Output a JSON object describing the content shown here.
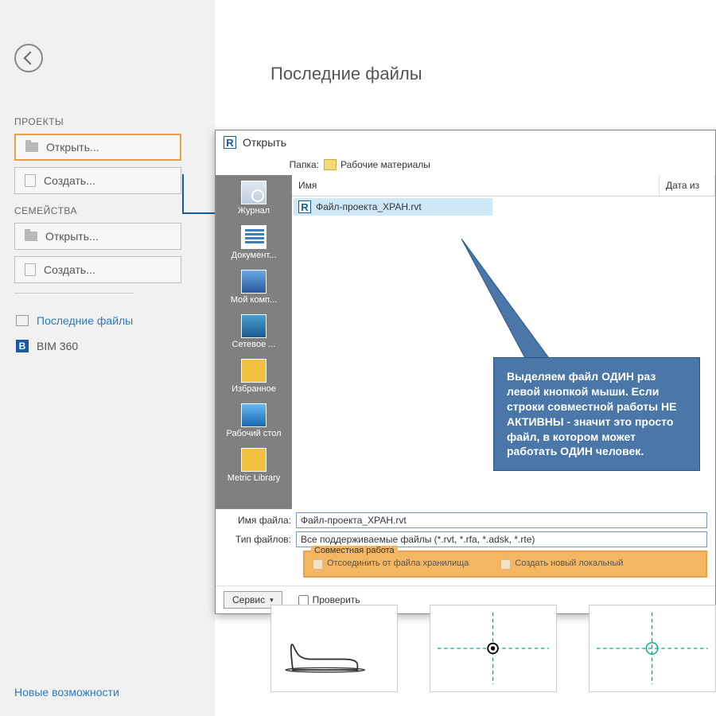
{
  "sidebar": {
    "projects_label": "ПРОЕКТЫ",
    "open_label": "Открыть...",
    "create_label": "Создать...",
    "families_label": "СЕМЕЙСТВА",
    "fam_open_label": "Открыть...",
    "fam_create_label": "Создать...",
    "recent_label": "Последние файлы",
    "bim360_label": "BIM 360",
    "new_features_label": "Новые возможности"
  },
  "main": {
    "title": "Последние файлы"
  },
  "dialog": {
    "title": "Открыть",
    "folder_label": "Папка:",
    "folder_value": "Рабочие материалы",
    "col_name": "Имя",
    "col_date": "Дата из",
    "file_name": "Файл-проекта_ХРАН.rvt",
    "places": {
      "journal": "Журнал",
      "documents": "Документ...",
      "mycomp": "Мой комп...",
      "network": "Сетевое ...",
      "favorites": "Избранное",
      "desktop": "Рабочий стол",
      "library": "Metric Library"
    },
    "filename_label": "Имя файла:",
    "filename_value": "Файл-проекта_ХРАН.rvt",
    "filetype_label": "Тип файлов:",
    "filetype_value": "Все поддерживаемые файлы (*.rvt, *.rfa, *.adsk, *.rte)",
    "workshare_title": "Совместная работа",
    "detach_label": "Отсоединить от файла хранилища",
    "newlocal_label": "Создать новый локальный",
    "service_label": "Сервис",
    "check_label": "Проверить"
  },
  "callout": {
    "text": "Выделяем файл ОДИН раз левой кнопкой мыши. Если строки совместной работы НЕ АКТИВНЫ - значит это просто файл, в котором может работать ОДИН человек."
  }
}
